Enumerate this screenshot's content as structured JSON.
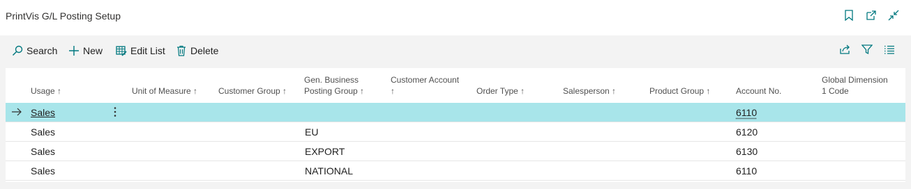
{
  "page": {
    "title": "PrintVis G/L Posting Setup"
  },
  "colors": {
    "accent": "#00787f",
    "selected_row": "#a8e5ea"
  },
  "title_icons": [
    "bookmark-icon",
    "open-new-window-icon",
    "collapse-icon"
  ],
  "actions": {
    "search": "Search",
    "new": "New",
    "edit_list": "Edit List",
    "delete": "Delete"
  },
  "right_actions": [
    "share-icon",
    "filter-icon",
    "list-view-icon"
  ],
  "columns": {
    "usage": "Usage ↑",
    "unit_of_measure": "Unit of Measure ↑",
    "customer_group": "Customer Group ↑",
    "gen_bus_line1": "Gen. Business",
    "gen_bus_line2": "Posting Group ↑",
    "cust_account_line1": "Customer Account",
    "cust_account_line2": "↑",
    "order_type": "Order Type ↑",
    "salesperson": "Salesperson ↑",
    "product_group": "Product Group ↑",
    "account_no": "Account No.",
    "global_dim_line1": "Global Dimension",
    "global_dim_line2": "1 Code"
  },
  "rows": [
    {
      "usage": "Sales",
      "gen_bus_posting_group": "",
      "account_no": "6110",
      "selected": true
    },
    {
      "usage": "Sales",
      "gen_bus_posting_group": "EU",
      "account_no": "6120",
      "selected": false
    },
    {
      "usage": "Sales",
      "gen_bus_posting_group": "EXPORT",
      "account_no": "6130",
      "selected": false
    },
    {
      "usage": "Sales",
      "gen_bus_posting_group": "NATIONAL",
      "account_no": "6110",
      "selected": false
    }
  ]
}
